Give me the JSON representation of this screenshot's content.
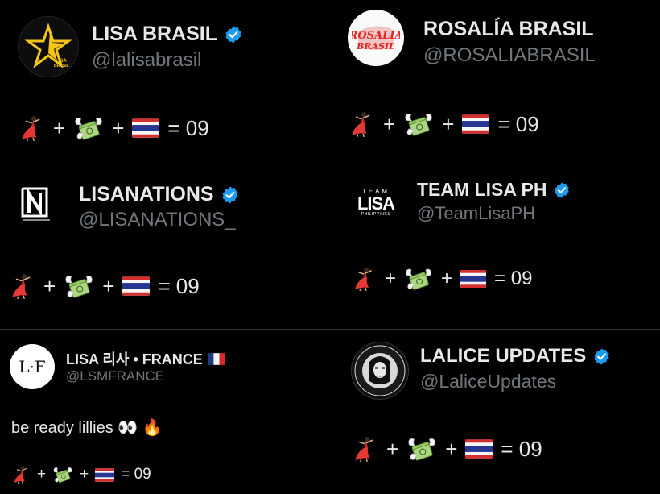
{
  "tweets": [
    {
      "name": "LISA BRASIL",
      "handle": "@lalisabrasil",
      "verified": true,
      "avatar": "lisa-brasil-star-logo",
      "avatar_text": "LISA BRASIL",
      "equation": {
        "parts": [
          "dancer-emoji",
          "+",
          "money-with-wings-emoji",
          "+",
          "thailand-flag-emoji"
        ],
        "result": "= 09"
      }
    },
    {
      "name": "ROSALÍA BRASIL",
      "handle": "@ROSALIABRASIL",
      "verified": false,
      "avatar": "rosalia-red-logo",
      "avatar_text": "ROSALIA",
      "equation": {
        "parts": [
          "dancer-emoji",
          "+",
          "money-with-wings-emoji",
          "+",
          "thailand-flag-emoji"
        ],
        "result": "= 09"
      }
    },
    {
      "name": "LISANATIONS",
      "handle": "@LISANATIONS_",
      "verified": true,
      "avatar": "lisanations-logo",
      "avatar_text": "N",
      "equation": {
        "parts": [
          "dancer-emoji",
          "+",
          "money-with-wings-emoji",
          "+",
          "thailand-flag-emoji"
        ],
        "result": "= 09"
      }
    },
    {
      "name": "TEAM LISA PH",
      "handle": "@TeamLisaPH",
      "verified": true,
      "avatar": "team-lisa-logo",
      "avatar_text": {
        "team": "TEAM",
        "lisa": "LISA",
        "ph": "PHILIPPINES"
      },
      "equation": {
        "parts": [
          "dancer-emoji",
          "+",
          "money-with-wings-emoji",
          "+",
          "thailand-flag-emoji"
        ],
        "result": "= 09"
      }
    },
    {
      "name": "LISA 리사 • FRANCE",
      "handle": "@LSMFRANCE",
      "verified": false,
      "avatar": "lf-logo",
      "avatar_text": "L·F",
      "body": "be ready lillies 👀 🔥",
      "equation": {
        "parts": [
          "dancer-emoji",
          "+",
          "money-with-wings-emoji",
          "+",
          "thailand-flag-emoji"
        ],
        "result": "= 09"
      }
    },
    {
      "name": "LALICE UPDATES",
      "handle": "@LaliceUpdates",
      "verified": true,
      "avatar": "lalice-portrait",
      "equation": {
        "parts": [
          "dancer-emoji",
          "+",
          "money-with-wings-emoji",
          "+",
          "thailand-flag-emoji"
        ],
        "result": "= 09"
      }
    }
  ],
  "colors": {
    "background": "#000000",
    "text": "#e7e9ea",
    "handle": "#71767b",
    "verified": "#1d9bf0",
    "divider": "#2f3336",
    "lisa_brasil_gold": "#f5c518",
    "rosalia_red": "#e02424"
  }
}
